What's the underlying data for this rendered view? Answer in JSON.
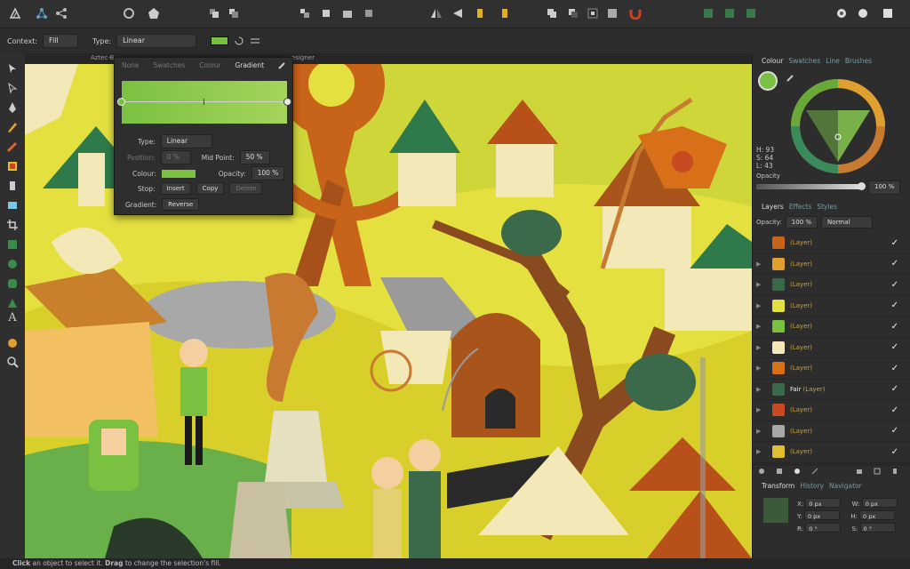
{
  "context_toolbar": {
    "context_label": "Context:",
    "context_value": "Fill",
    "type_label": "Type:",
    "type_value": "Linear"
  },
  "doc_tabs": {
    "left": "Aztec-B",
    "right": "esigner"
  },
  "gradient_popup": {
    "tabs": [
      "None",
      "Swatches",
      "Colour",
      "Gradient"
    ],
    "type_label": "Type:",
    "type_value": "Linear",
    "position_label": "Position:",
    "position_value": "0 %",
    "midpoint_label": "Mid Point:",
    "midpoint_value": "50 %",
    "colour_label": "Colour:",
    "opacity_label": "Opacity:",
    "opacity_value": "100 %",
    "stop_label": "Stop:",
    "insert_label": "Insert",
    "copy_label": "Copy",
    "delete_label": "Delete",
    "gradient_label": "Gradient:",
    "reverse_label": "Reverse"
  },
  "colour_panel": {
    "tabs": [
      "Colour",
      "Swatches",
      "Line",
      "Brushes"
    ],
    "h": "H: 93",
    "s": "S: 64",
    "l": "L: 43",
    "opacity_label": "Opacity",
    "opacity_value": "100 %"
  },
  "layers_panel": {
    "tabs": [
      "Layers",
      "Effects",
      "Styles"
    ],
    "opacity_label": "Opacity:",
    "opacity_value": "100 %",
    "blend_value": "Normal",
    "rows": [
      {
        "name": "",
        "type": "(Layer)"
      },
      {
        "name": "",
        "type": "(Layer)"
      },
      {
        "name": "",
        "type": "(Layer)"
      },
      {
        "name": "",
        "type": "(Layer)"
      },
      {
        "name": "",
        "type": "(Layer)"
      },
      {
        "name": "",
        "type": "(Layer)"
      },
      {
        "name": "",
        "type": "(Layer)"
      },
      {
        "name": "Fair",
        "type": "(Layer)"
      },
      {
        "name": "",
        "type": "(Layer)"
      },
      {
        "name": "",
        "type": "(Layer)"
      },
      {
        "name": "",
        "type": "(Layer)"
      }
    ]
  },
  "transform_panel": {
    "tabs": [
      "Transform",
      "History",
      "Navigator"
    ],
    "x_label": "X:",
    "x_value": "0 px",
    "y_label": "Y:",
    "y_value": "0 px",
    "w_label": "W:",
    "w_value": "0 px",
    "h_label": "H:",
    "h_value": "0 px",
    "r_label": "R:",
    "r_value": "0 °",
    "s_label": "S:",
    "s_value": "0 °"
  },
  "status_bar": {
    "b1": "Click",
    "t1": " an object to select it. ",
    "b2": "Drag",
    "t2": " to change the selection's fill."
  },
  "colors": {
    "accent_green": "#7ac142",
    "layer_label": "#c8a040",
    "canvas_yellow": "#e6e23a"
  }
}
